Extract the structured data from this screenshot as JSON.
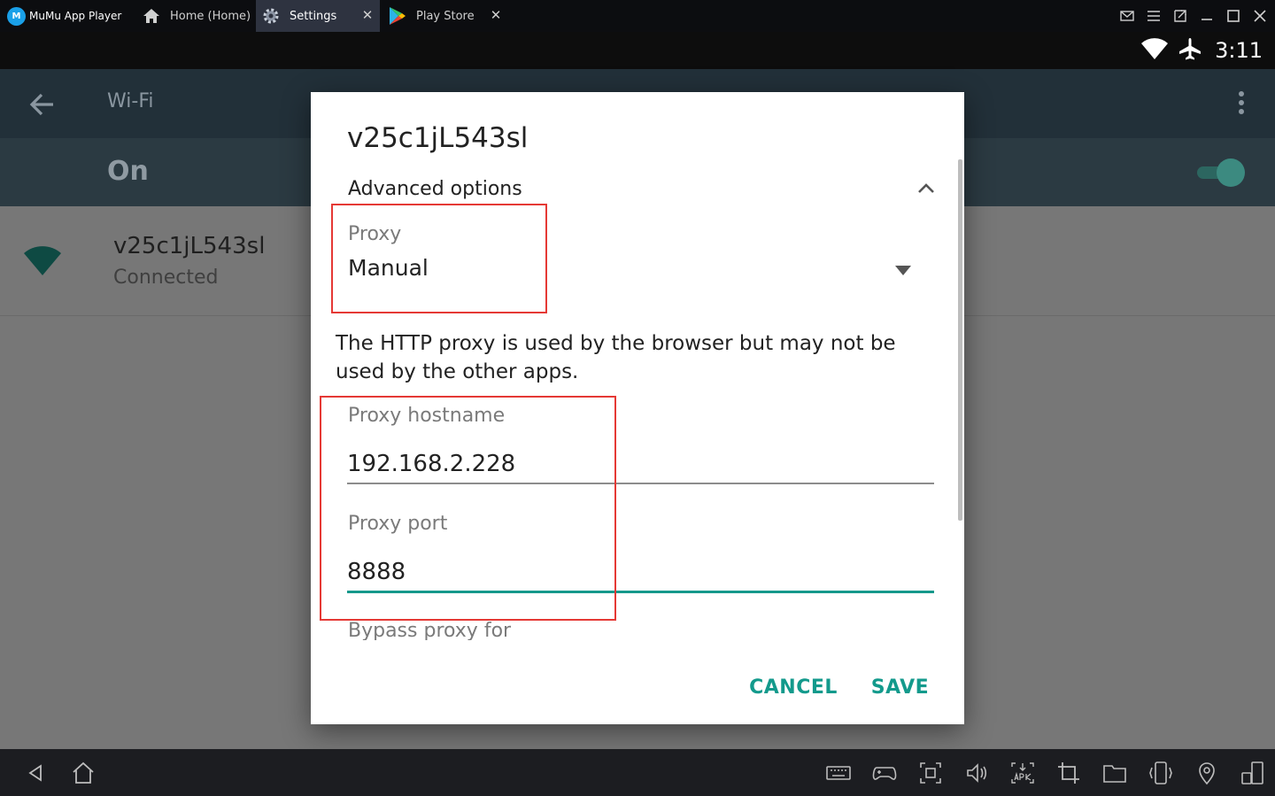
{
  "emulator": {
    "app_name": "MuMu App Player",
    "logo_text": "M",
    "tabs": [
      {
        "label": "Home (Home)",
        "icon": "home-icon"
      },
      {
        "label": "Settings",
        "icon": "gear-icon",
        "active": true
      },
      {
        "label": "Play Store",
        "icon": "play-store-icon"
      }
    ],
    "close_glyph": "✕"
  },
  "statusbar": {
    "time": "3:11"
  },
  "screen": {
    "appbar_title": "Wi-Fi",
    "switch_label": "On",
    "network": {
      "name": "v25c1jL543sl",
      "status": "Connected"
    }
  },
  "dialog": {
    "title": "v25c1jL543sl",
    "advanced_options_label": "Advanced options",
    "proxy_label": "Proxy",
    "proxy_value": "Manual",
    "info_text": "The HTTP proxy is used by the browser but may not be used by the other apps.",
    "hostname_label": "Proxy hostname",
    "hostname_value": "192.168.2.228",
    "port_label": "Proxy port",
    "port_value": "8888",
    "bypass_label": "Bypass proxy for",
    "cancel_label": "CANCEL",
    "save_label": "SAVE"
  },
  "colors": {
    "accent": "#139a8c",
    "annotation": "#e53935",
    "active_tab": "#2e3340"
  }
}
